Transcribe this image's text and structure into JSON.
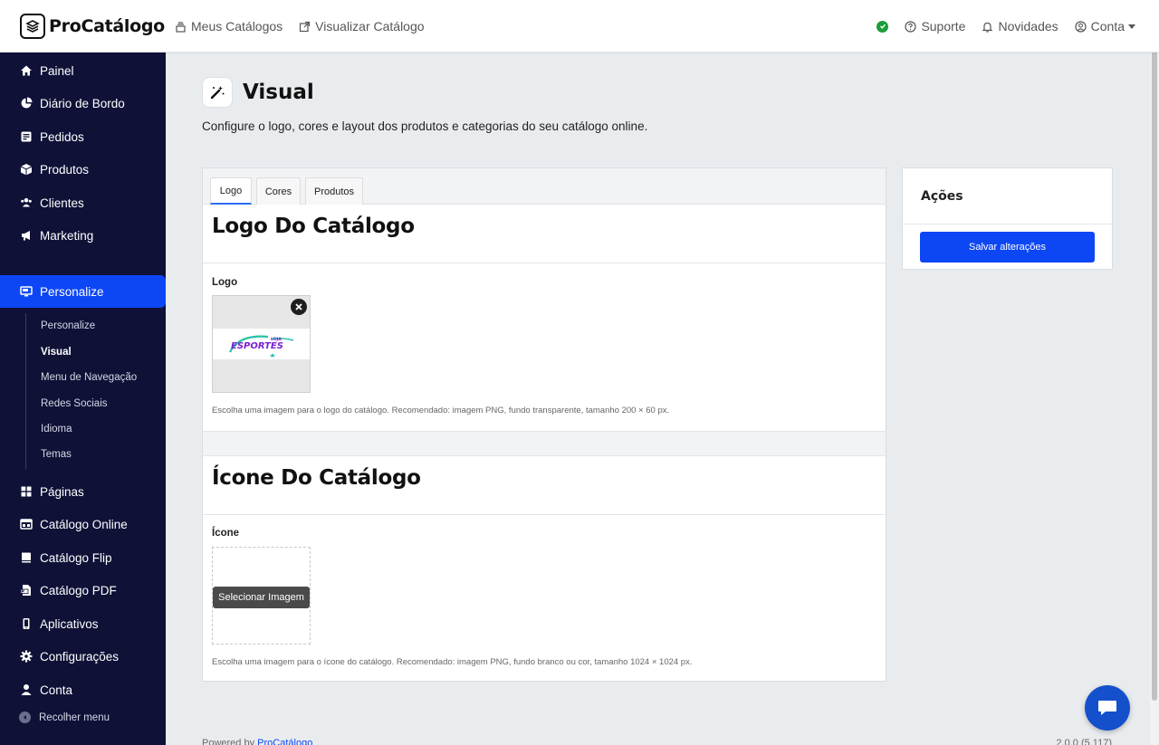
{
  "brand": {
    "name": "ProCatálogo"
  },
  "topnav": {
    "catalogs": "Meus Catálogos",
    "view": "Visualizar Catálogo"
  },
  "topright": {
    "support": "Suporte",
    "news": "Novidades",
    "account": "Conta"
  },
  "sidebar": {
    "items": [
      {
        "label": "Painel",
        "icon": "home-icon"
      },
      {
        "label": "Diário de Bordo",
        "icon": "pie-chart-icon"
      },
      {
        "label": "Pedidos",
        "icon": "orders-icon"
      },
      {
        "label": "Produtos",
        "icon": "box-icon"
      },
      {
        "label": "Clientes",
        "icon": "users-icon"
      },
      {
        "label": "Marketing",
        "icon": "megaphone-icon"
      },
      {
        "label": "Personalize",
        "icon": "monitor-icon"
      },
      {
        "label": "Páginas",
        "icon": "grid-icon"
      },
      {
        "label": "Catálogo Online",
        "icon": "online-catalog-icon"
      },
      {
        "label": "Catálogo Flip",
        "icon": "book-icon"
      },
      {
        "label": "Catálogo PDF",
        "icon": "pdf-icon"
      },
      {
        "label": "Aplicativos",
        "icon": "mobile-icon"
      },
      {
        "label": "Configurações",
        "icon": "gear-icon"
      },
      {
        "label": "Conta",
        "icon": "user-icon"
      }
    ],
    "subitems": [
      "Personalize",
      "Visual",
      "Menu de Navegação",
      "Redes Sociais",
      "Idioma",
      "Temas"
    ],
    "collapse": "Recolher menu"
  },
  "page": {
    "title": "Visual",
    "description": "Configure o logo, cores e layout dos produtos e categorias do seu catálogo online."
  },
  "tabs": [
    "Logo",
    "Cores",
    "Produtos"
  ],
  "logo_section": {
    "title": "Logo Do Catálogo",
    "label": "Logo",
    "logo_text": "ESPORTES",
    "logo_small": "LOJA",
    "help": "Escolha uma imagem para o logo do catálogo. Recomendado: imagem PNG, fundo transparente, tamanho 200 × 60 px."
  },
  "icon_section": {
    "title": "Ícone Do Catálogo",
    "label": "Ícone",
    "select_button": "Selecionar Imagem",
    "help": "Escolha uma imagem para o ícone do catálogo. Recomendado: imagem PNG, fundo branco ou cor, tamanho 1024 × 1024 px."
  },
  "actions": {
    "title": "Ações",
    "save": "Salvar alterações"
  },
  "footer": {
    "powered": "Powered by",
    "link": "ProCatálogo",
    "version": "2.0.0 (5.117)"
  },
  "colors": {
    "sidebar_bg": "#0f1137",
    "accent": "#0d47f5",
    "status_ok": "#1a9d3a"
  }
}
